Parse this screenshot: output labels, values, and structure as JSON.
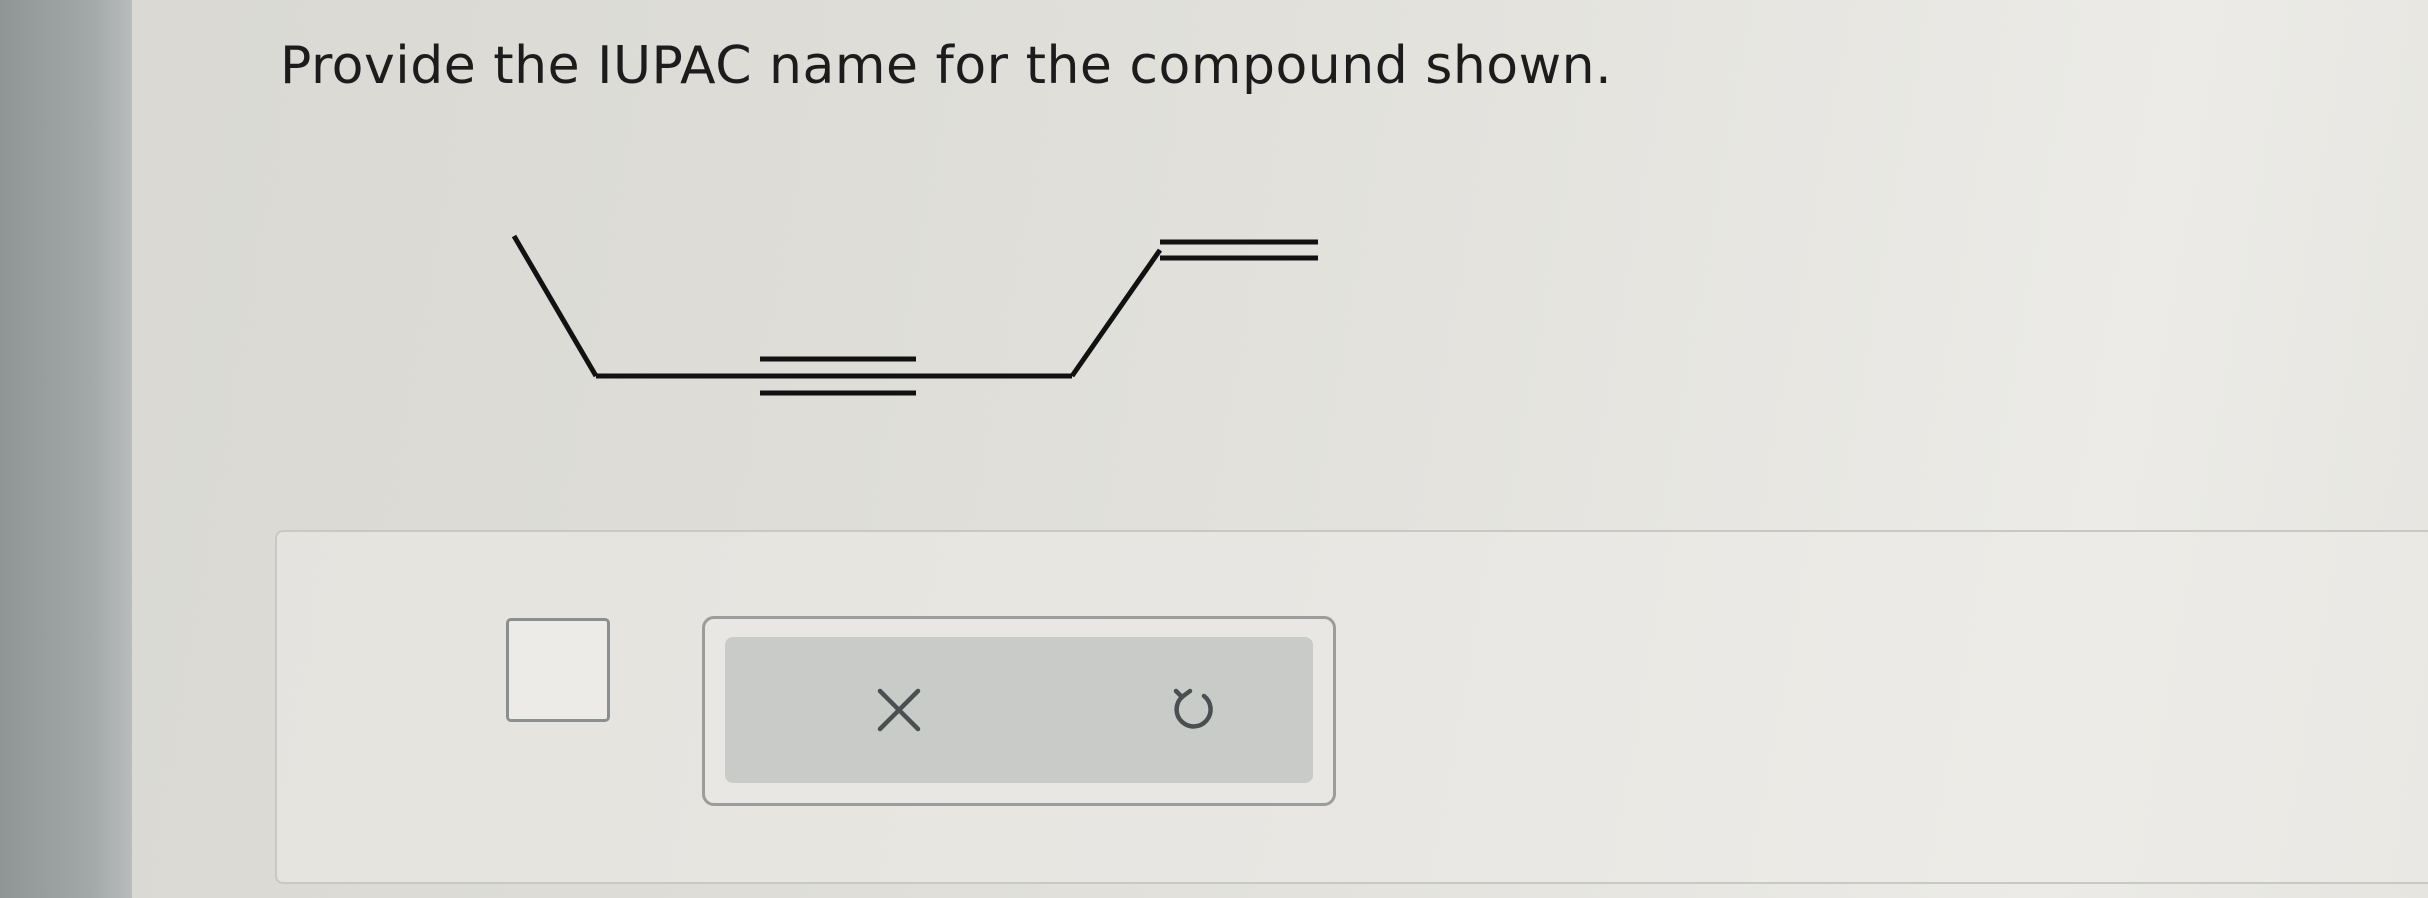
{
  "question": {
    "text": "Provide the IUPAC name for the compound shown."
  },
  "molecule": {
    "description_bonds": [
      "single",
      "single",
      "triple",
      "single",
      "single",
      "double"
    ]
  },
  "answer": {
    "value": ""
  },
  "toolbar": {
    "clear_icon": "close-icon",
    "undo_icon": "undo-icon"
  },
  "colors": {
    "text": "#1c1c1c",
    "bond": "#111111",
    "tool_background": "#c9cbc8",
    "icon": "#4a4f52"
  }
}
